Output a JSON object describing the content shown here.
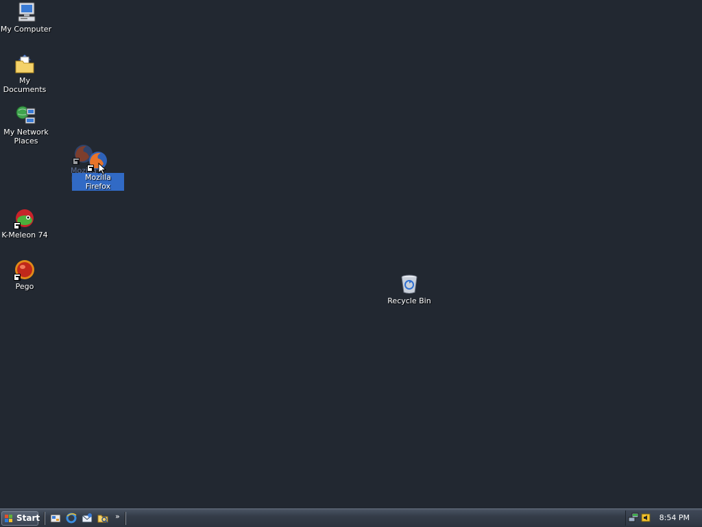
{
  "desktop": {
    "icons": {
      "my_computer": "My Computer",
      "my_documents": "My Documents",
      "my_network_places": "My Network Places",
      "firefox_drag_ghost": "Mozilla Firefox",
      "firefox": "Mozilla Firefox",
      "kmeleon": "K-Meleon 74",
      "pego": "Pego",
      "recycle_bin": "Recycle Bin"
    }
  },
  "taskbar": {
    "start_label": "Start",
    "quick_launch": [
      "show-desktop-icon",
      "internet-explorer-icon",
      "outlook-express-icon",
      "windows-explorer-icon"
    ],
    "overflow_label": "»",
    "tray_icons": [
      "network-icon",
      "volume-icon"
    ],
    "clock": "8:54 PM"
  },
  "colors": {
    "desktop_background": "#222831",
    "selection": "#316ac5"
  }
}
